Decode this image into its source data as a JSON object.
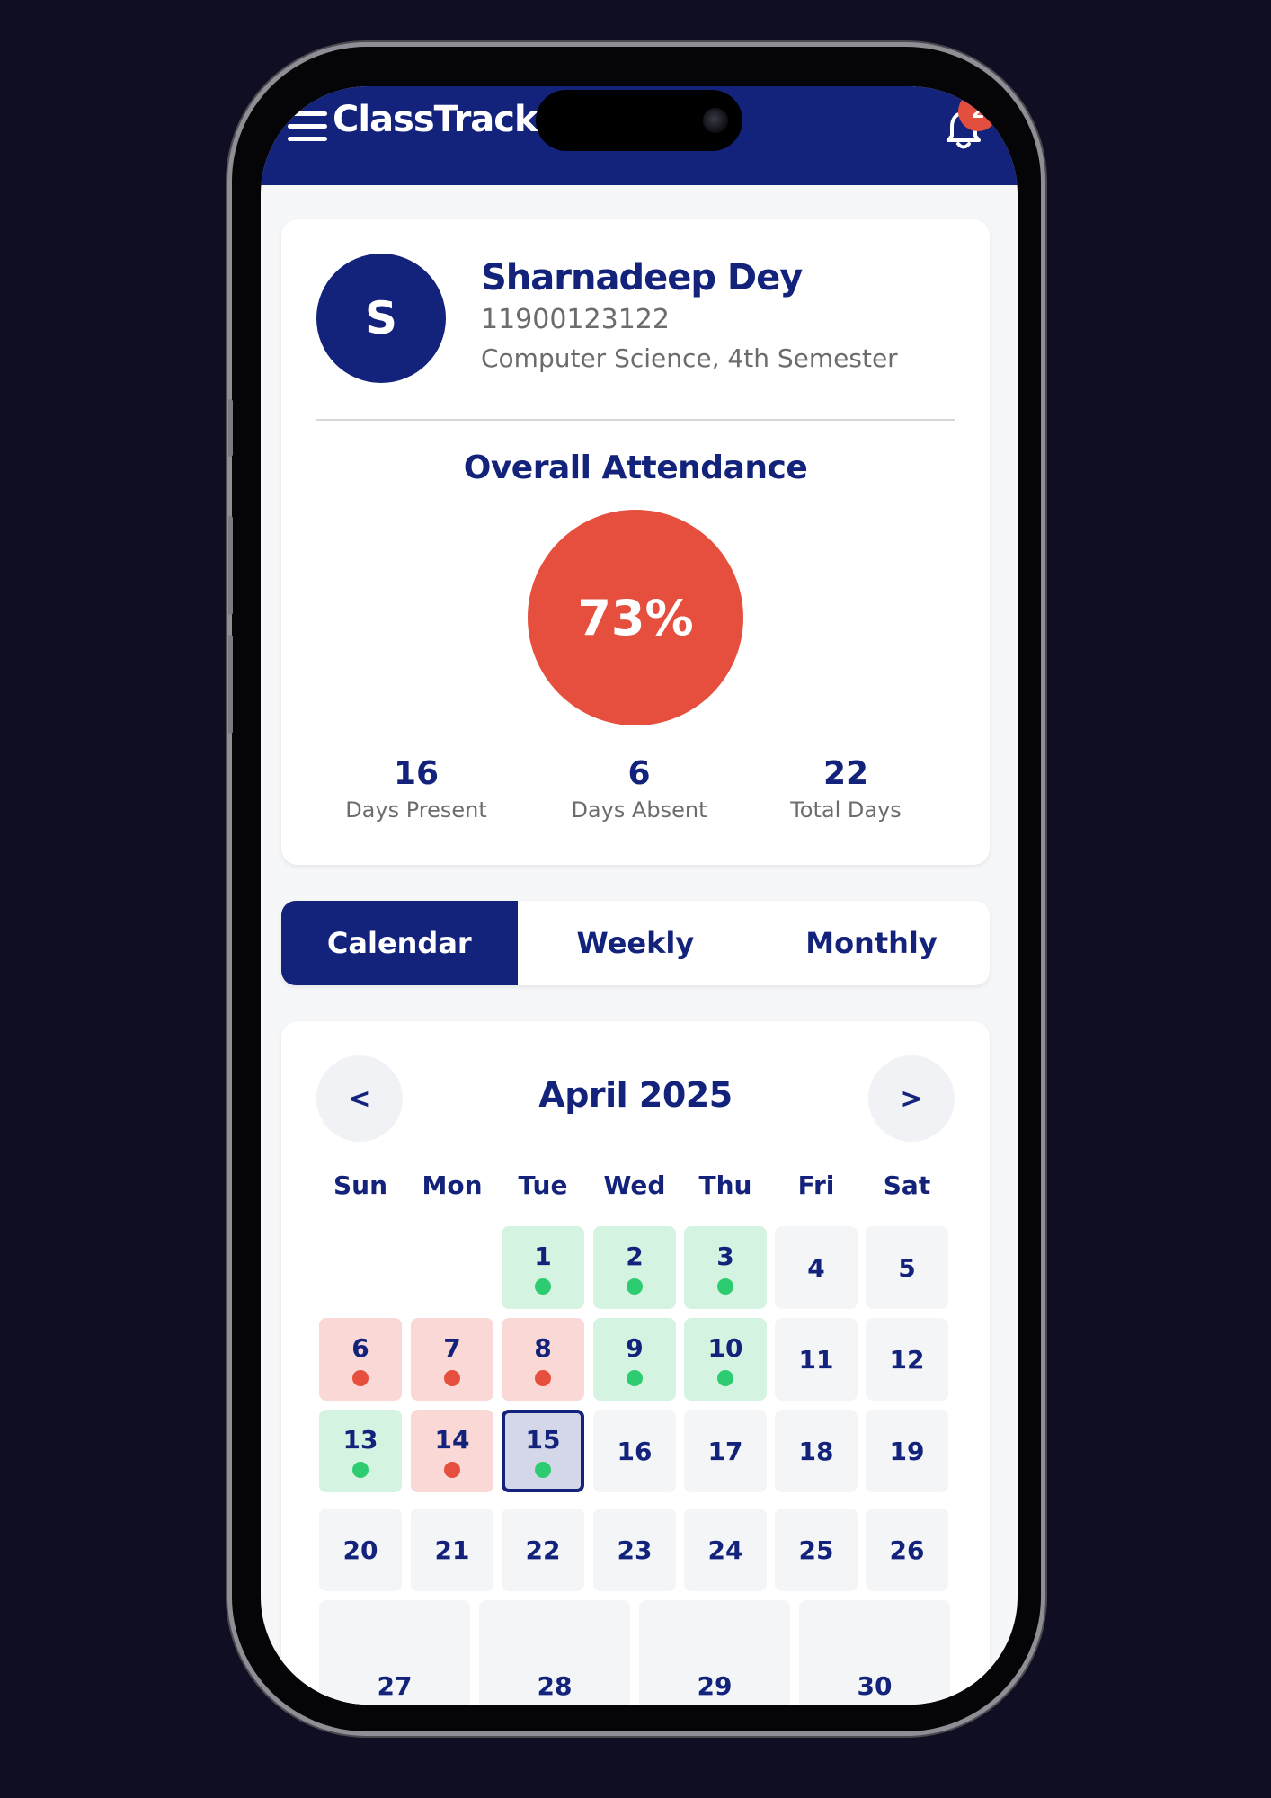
{
  "app": {
    "title": "ClassTrack",
    "notification_count": "2"
  },
  "student": {
    "initial": "S",
    "name": "Sharnadeep Dey",
    "id": "11900123122",
    "department": "Computer Science, 4th Semester"
  },
  "attendance": {
    "title": "Overall Attendance",
    "percent_label": "73%",
    "percent_value": 73,
    "stats": [
      {
        "value": "16",
        "label": "Days Present"
      },
      {
        "value": "6",
        "label": "Days Absent"
      },
      {
        "value": "22",
        "label": "Total Days"
      }
    ]
  },
  "tabs": [
    {
      "label": "Calendar",
      "active": true
    },
    {
      "label": "Weekly",
      "active": false
    },
    {
      "label": "Monthly",
      "active": false
    }
  ],
  "calendar": {
    "month_label": "April 2025",
    "prev_label": "<",
    "next_label": ">",
    "weekdays": [
      "Sun",
      "Mon",
      "Tue",
      "Wed",
      "Thu",
      "Fri",
      "Sat"
    ],
    "selected_day": "15",
    "days": [
      {
        "day": "1",
        "status": "present"
      },
      {
        "day": "2",
        "status": "present"
      },
      {
        "day": "3",
        "status": "present"
      },
      {
        "day": "4",
        "status": "none"
      },
      {
        "day": "5",
        "status": "none"
      },
      {
        "day": "6",
        "status": "absent"
      },
      {
        "day": "7",
        "status": "absent"
      },
      {
        "day": "8",
        "status": "absent"
      },
      {
        "day": "9",
        "status": "present"
      },
      {
        "day": "10",
        "status": "present"
      },
      {
        "day": "11",
        "status": "none"
      },
      {
        "day": "12",
        "status": "none"
      },
      {
        "day": "13",
        "status": "present"
      },
      {
        "day": "14",
        "status": "absent"
      },
      {
        "day": "15",
        "status": "present"
      },
      {
        "day": "16",
        "status": "none"
      },
      {
        "day": "17",
        "status": "none"
      },
      {
        "day": "18",
        "status": "none"
      },
      {
        "day": "19",
        "status": "none"
      },
      {
        "day": "20",
        "status": "none"
      },
      {
        "day": "21",
        "status": "none"
      },
      {
        "day": "22",
        "status": "none"
      },
      {
        "day": "23",
        "status": "none"
      },
      {
        "day": "24",
        "status": "none"
      },
      {
        "day": "25",
        "status": "none"
      },
      {
        "day": "26",
        "status": "none"
      },
      {
        "day": "27",
        "status": "none"
      },
      {
        "day": "28",
        "status": "none"
      },
      {
        "day": "29",
        "status": "none"
      },
      {
        "day": "30",
        "status": "none"
      }
    ]
  },
  "colors": {
    "primary": "#13227a",
    "present": "#2ecc71",
    "absent": "#e64f3e",
    "present_bg": "#d4f3e1",
    "absent_bg": "#f9d8d6"
  }
}
